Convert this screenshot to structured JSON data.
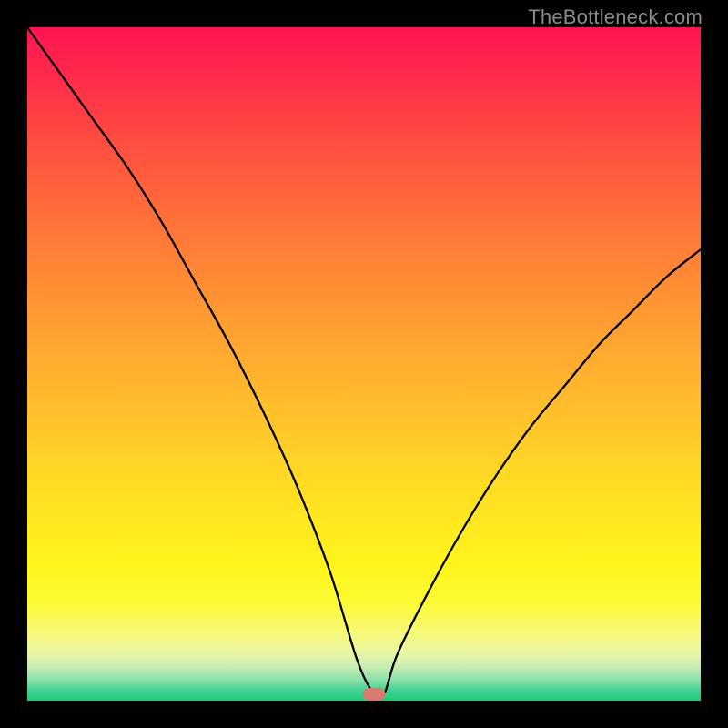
{
  "watermark": "TheBottleneck.com",
  "chart_data": {
    "type": "line",
    "title": "",
    "xlabel": "",
    "ylabel": "",
    "xlim": [
      0,
      100
    ],
    "ylim": [
      0,
      100
    ],
    "grid": false,
    "legend": false,
    "background": "gradient red→yellow→green",
    "series": [
      {
        "name": "bottleneck-curve",
        "x": [
          0,
          5,
          10,
          15,
          20,
          25,
          30,
          35,
          40,
          45,
          49,
          51.5,
          53,
          55,
          60,
          65,
          70,
          75,
          80,
          85,
          90,
          95,
          100
        ],
        "values": [
          100,
          93,
          86,
          79,
          71,
          62,
          53,
          43,
          32,
          19,
          6,
          1,
          1,
          7,
          17,
          26,
          34,
          41,
          47,
          53,
          58,
          63,
          67
        ]
      }
    ],
    "marker": {
      "x": 51.5,
      "y": 1,
      "shape": "rounded-rect",
      "color": "#d97b6f"
    }
  }
}
